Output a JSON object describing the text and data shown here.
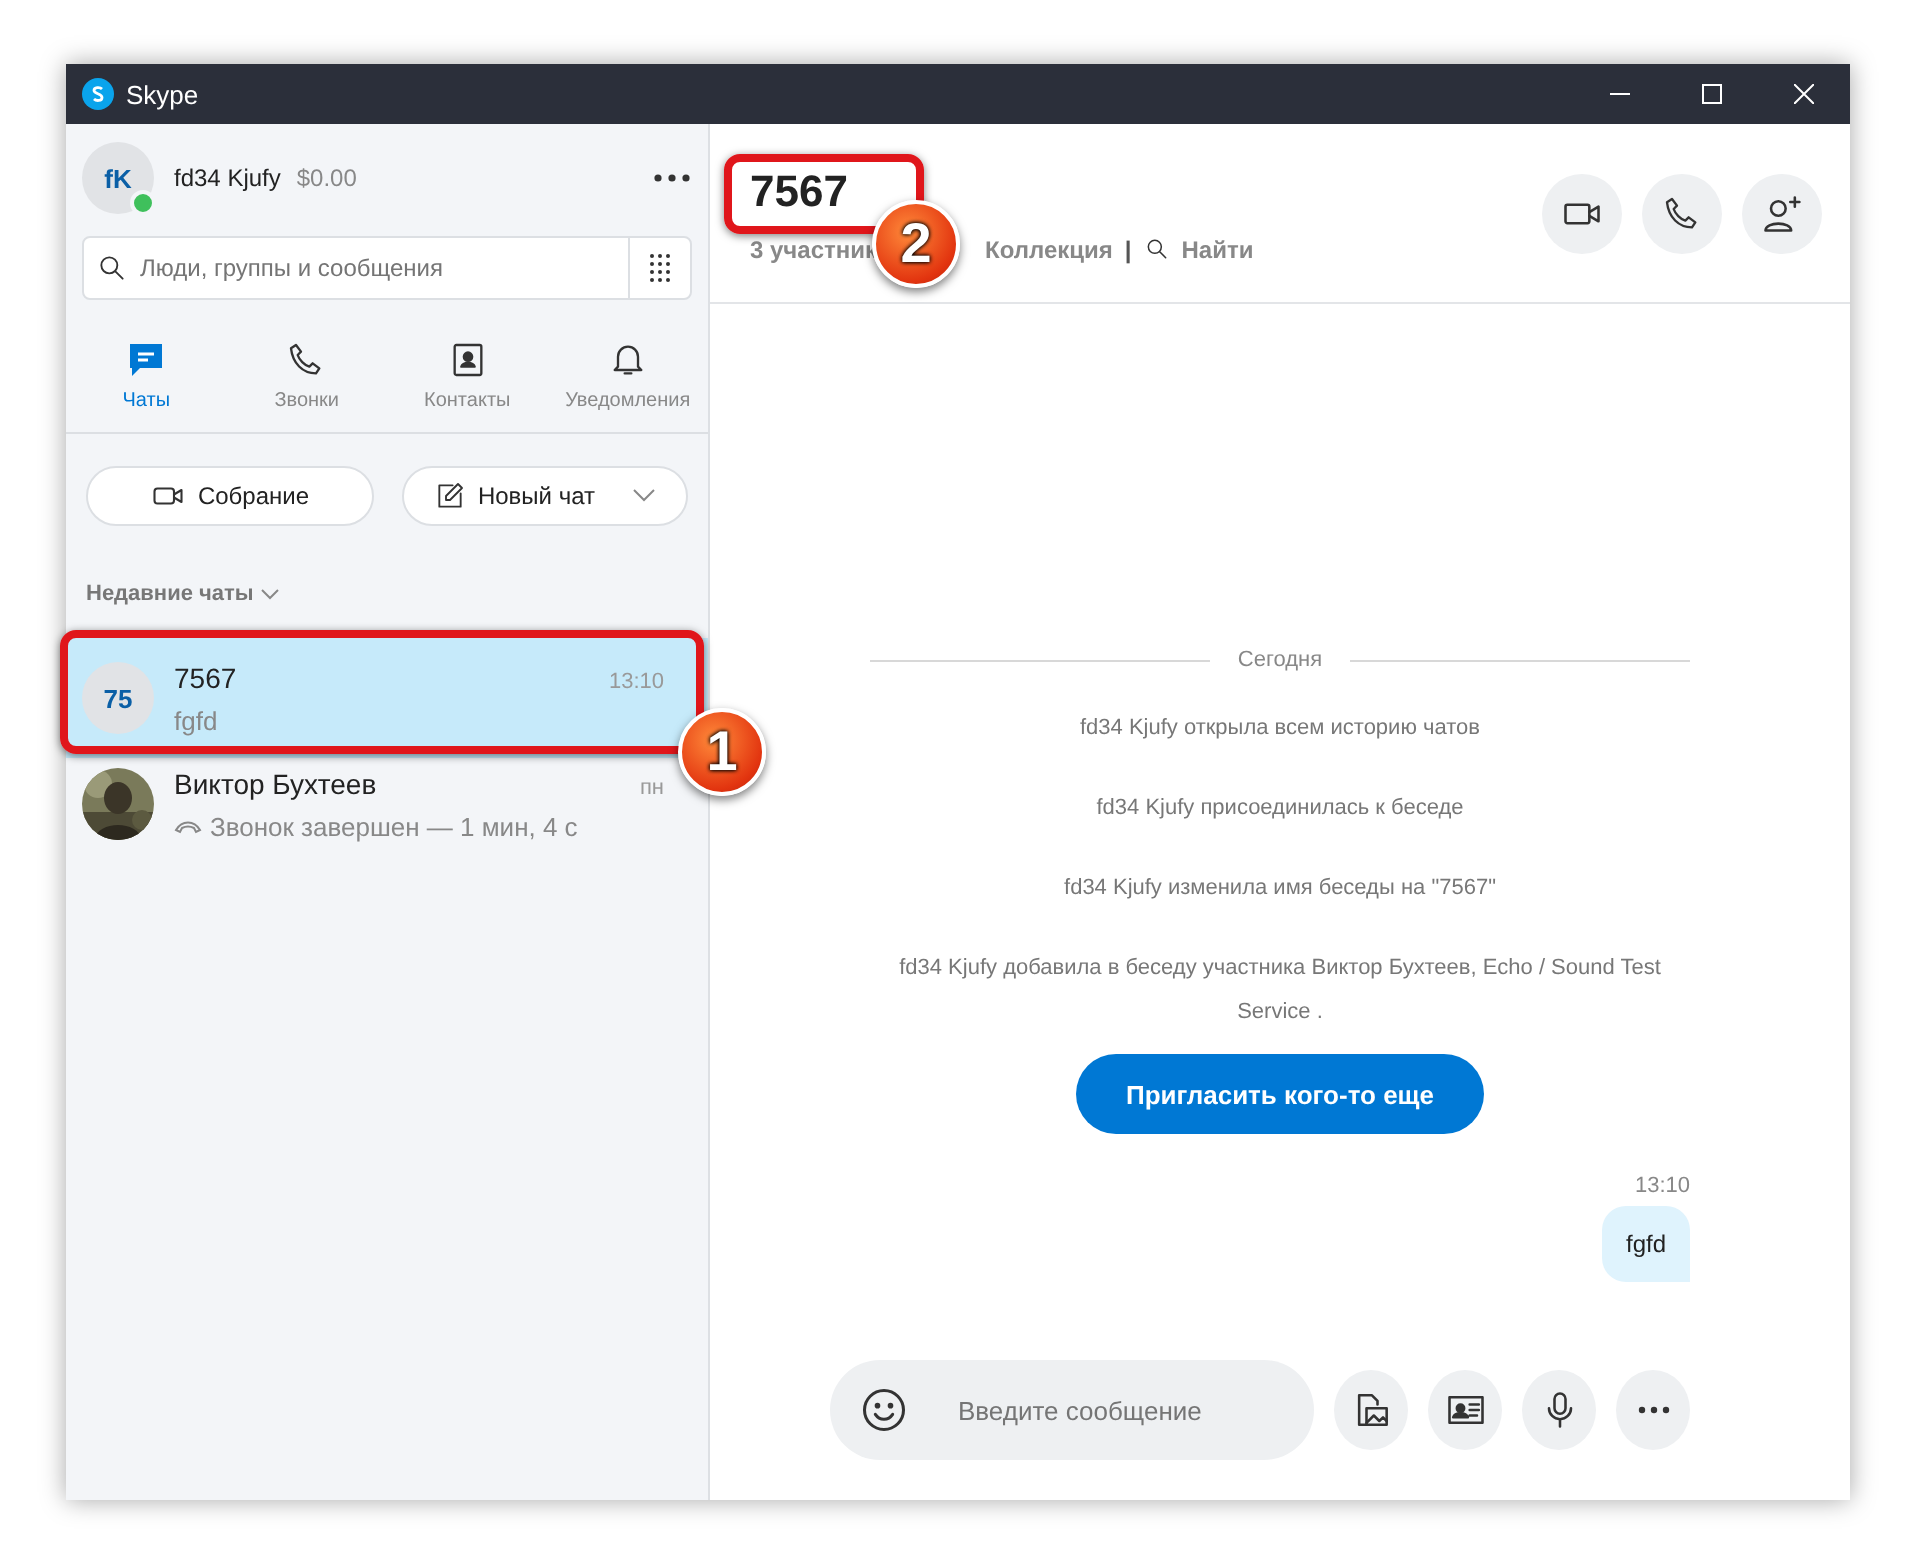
{
  "window": {
    "title": "Skype"
  },
  "profile": {
    "initials": "fK",
    "name": "fd34 Kjufy",
    "balance": "$0.00",
    "online": true
  },
  "search": {
    "placeholder": "Люди, группы и сообщения"
  },
  "nav_tabs": [
    {
      "kind": "chat",
      "label": "Чаты",
      "selected": true
    },
    {
      "kind": "call",
      "label": "Звонки",
      "selected": false
    },
    {
      "kind": "contacts",
      "label": "Контакты",
      "selected": false
    },
    {
      "kind": "bell",
      "label": "Уведомления",
      "selected": false
    }
  ],
  "actions": [
    {
      "kind": "meeting",
      "label": "Собрание"
    },
    {
      "kind": "new",
      "label": "Новый чат"
    }
  ],
  "recent_label": "Недавние чаты",
  "chats": [
    {
      "kind": "initials",
      "avatar_text": "75",
      "name": "7567",
      "time": "13:10",
      "preview": "fgfd",
      "selected": true
    },
    {
      "name": "Виктор Бухтеев",
      "time": "пн",
      "preview": "Звонок завершен — 1 мин, 4 с",
      "selected": false
    }
  ],
  "conversation": {
    "title": "7567",
    "participants": "3 участник",
    "gallery": "Коллекция",
    "separator": "|",
    "find": "Найти",
    "date_divider": "Сегодня",
    "events": [
      "fd34 Kjufy открыла всем историю чатов",
      "fd34 Kjufy присоединилась к беседе",
      "fd34 Kjufy изменила имя беседы на \"7567\"",
      "fd34 Kjufy добавила в беседу участника Виктор Бухтеев, Echo / Sound Test Service ."
    ],
    "invite_button": "Пригласить кого-то еще",
    "messages": [
      {
        "time": "13:10",
        "text": "fgfd"
      }
    ],
    "composer": {
      "placeholder": "Введите сообщение"
    }
  },
  "annotations": [
    {
      "number": "1"
    },
    {
      "number": "2"
    }
  ]
}
